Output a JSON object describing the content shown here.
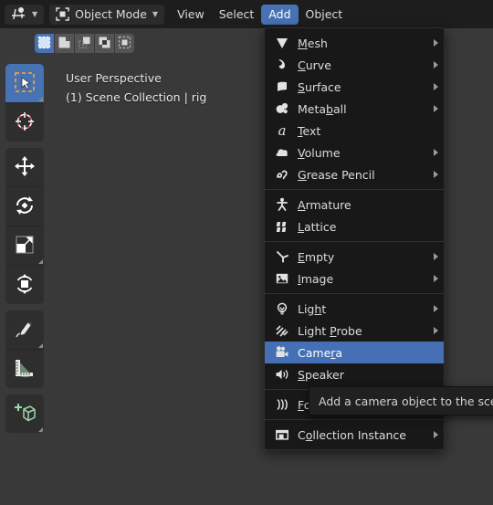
{
  "app": {
    "name": "Blender 3D Viewport",
    "accent_blue": "#4772b3",
    "menu_highlight": "#4570b5",
    "tool_green": "#9bd6ad"
  },
  "header": {
    "editor_type_icon": "editor-type-3d-viewport-icon",
    "mode_selector": {
      "icon": "object-mode-icon",
      "label": "Object Mode",
      "chevron": "chevron-down-icon"
    },
    "menus": [
      {
        "label": "View",
        "active": false
      },
      {
        "label": "Select",
        "active": false
      },
      {
        "label": "Add",
        "active": true
      },
      {
        "label": "Object",
        "active": false
      }
    ]
  },
  "select_mode": {
    "buttons": [
      {
        "name": "set-select-mode",
        "icon": "select-set-icon",
        "active": true
      },
      {
        "name": "extend-select-mode",
        "icon": "select-extend-icon",
        "active": false
      },
      {
        "name": "subtract-select-mode",
        "icon": "select-subtract-icon",
        "active": false
      },
      {
        "name": "invert-select-mode",
        "icon": "select-invert-icon",
        "active": false
      },
      {
        "name": "intersect-select-mode",
        "icon": "select-intersect-icon",
        "active": false
      }
    ]
  },
  "viewport": {
    "perspective_label": "User Perspective",
    "scene_label": "(1) Scene Collection | rig",
    "background_color": "#393939"
  },
  "toolbar": {
    "groups": [
      {
        "tools": [
          {
            "name": "tweak-select-box-tool",
            "icon": "select-box-icon",
            "label": "Select Box",
            "active": true,
            "has_corner": true
          },
          {
            "name": "cursor-tool",
            "icon": "cursor-3d-icon",
            "label": "Cursor",
            "active": false,
            "has_corner": false
          }
        ]
      },
      {
        "tools": [
          {
            "name": "move-tool",
            "icon": "move-icon",
            "label": "Move",
            "active": false,
            "has_corner": false
          },
          {
            "name": "rotate-tool",
            "icon": "rotate-icon",
            "label": "Rotate",
            "active": false,
            "has_corner": false
          },
          {
            "name": "scale-tool",
            "icon": "scale-icon",
            "label": "Scale",
            "active": false,
            "has_corner": true
          },
          {
            "name": "transform-tool",
            "icon": "transform-icon",
            "label": "Transform",
            "active": false,
            "has_corner": false
          }
        ]
      },
      {
        "tools": [
          {
            "name": "annotate-tool",
            "icon": "annotate-pencil-icon",
            "label": "Annotate",
            "active": false,
            "has_corner": true
          },
          {
            "name": "measure-tool",
            "icon": "measure-ruler-icon",
            "label": "Measure",
            "active": false,
            "has_corner": false
          }
        ]
      },
      {
        "tools": [
          {
            "name": "add-cube-tool",
            "icon": "add-cube-icon",
            "label": "Add Cube",
            "active": false,
            "has_corner": true
          }
        ]
      }
    ]
  },
  "add_menu": {
    "items": [
      {
        "type": "item",
        "label": "Mesh",
        "accel": "M",
        "icon": "mesh-cone-icon",
        "submenu": true,
        "selected": false
      },
      {
        "type": "item",
        "label": "Curve",
        "accel": "C",
        "icon": "curve-icon",
        "submenu": true,
        "selected": false
      },
      {
        "type": "item",
        "label": "Surface",
        "accel": "S",
        "icon": "surface-icon",
        "submenu": true,
        "selected": false
      },
      {
        "type": "item",
        "label": "Metaball",
        "accel": "b",
        "icon": "metaball-icon",
        "submenu": true,
        "selected": false
      },
      {
        "type": "item",
        "label": "Text",
        "accel": "T",
        "icon": "text-a-icon",
        "submenu": false,
        "selected": false
      },
      {
        "type": "item",
        "label": "Volume",
        "accel": "V",
        "icon": "volume-cloud-icon",
        "submenu": true,
        "selected": false
      },
      {
        "type": "item",
        "label": "Grease Pencil",
        "accel": "G",
        "icon": "grease-pencil-icon",
        "submenu": true,
        "selected": false
      },
      {
        "type": "separator"
      },
      {
        "type": "item",
        "label": "Armature",
        "accel": "A",
        "icon": "armature-icon",
        "submenu": false,
        "selected": false
      },
      {
        "type": "item",
        "label": "Lattice",
        "accel": "L",
        "icon": "lattice-icon",
        "submenu": false,
        "selected": false
      },
      {
        "type": "separator"
      },
      {
        "type": "item",
        "label": "Empty",
        "accel": "E",
        "icon": "empty-axis-icon",
        "submenu": true,
        "selected": false
      },
      {
        "type": "item",
        "label": "Image",
        "accel": "I",
        "icon": "image-icon",
        "submenu": true,
        "selected": false
      },
      {
        "type": "separator"
      },
      {
        "type": "item",
        "label": "Light",
        "accel": "h",
        "icon": "light-bulb-icon",
        "submenu": true,
        "selected": false
      },
      {
        "type": "item",
        "label": "Light Probe",
        "accel": "P",
        "icon": "light-probe-icon",
        "submenu": true,
        "selected": false
      },
      {
        "type": "item",
        "label": "Camera",
        "accel": "r",
        "icon": "camera-icon",
        "submenu": false,
        "selected": true
      },
      {
        "type": "item",
        "label": "Speaker",
        "accel": "S",
        "icon": "speaker-icon",
        "submenu": false,
        "selected": false
      },
      {
        "type": "separator"
      },
      {
        "type": "item",
        "label": "Force Field",
        "accel": "F",
        "icon": "force-field-icon",
        "submenu": true,
        "selected": false
      },
      {
        "type": "separator"
      },
      {
        "type": "item",
        "label": "Collection Instance",
        "accel": "o",
        "icon": "collection-instance-icon",
        "submenu": true,
        "selected": false
      }
    ]
  },
  "tooltip": {
    "text": "Add a camera object to the scene"
  }
}
